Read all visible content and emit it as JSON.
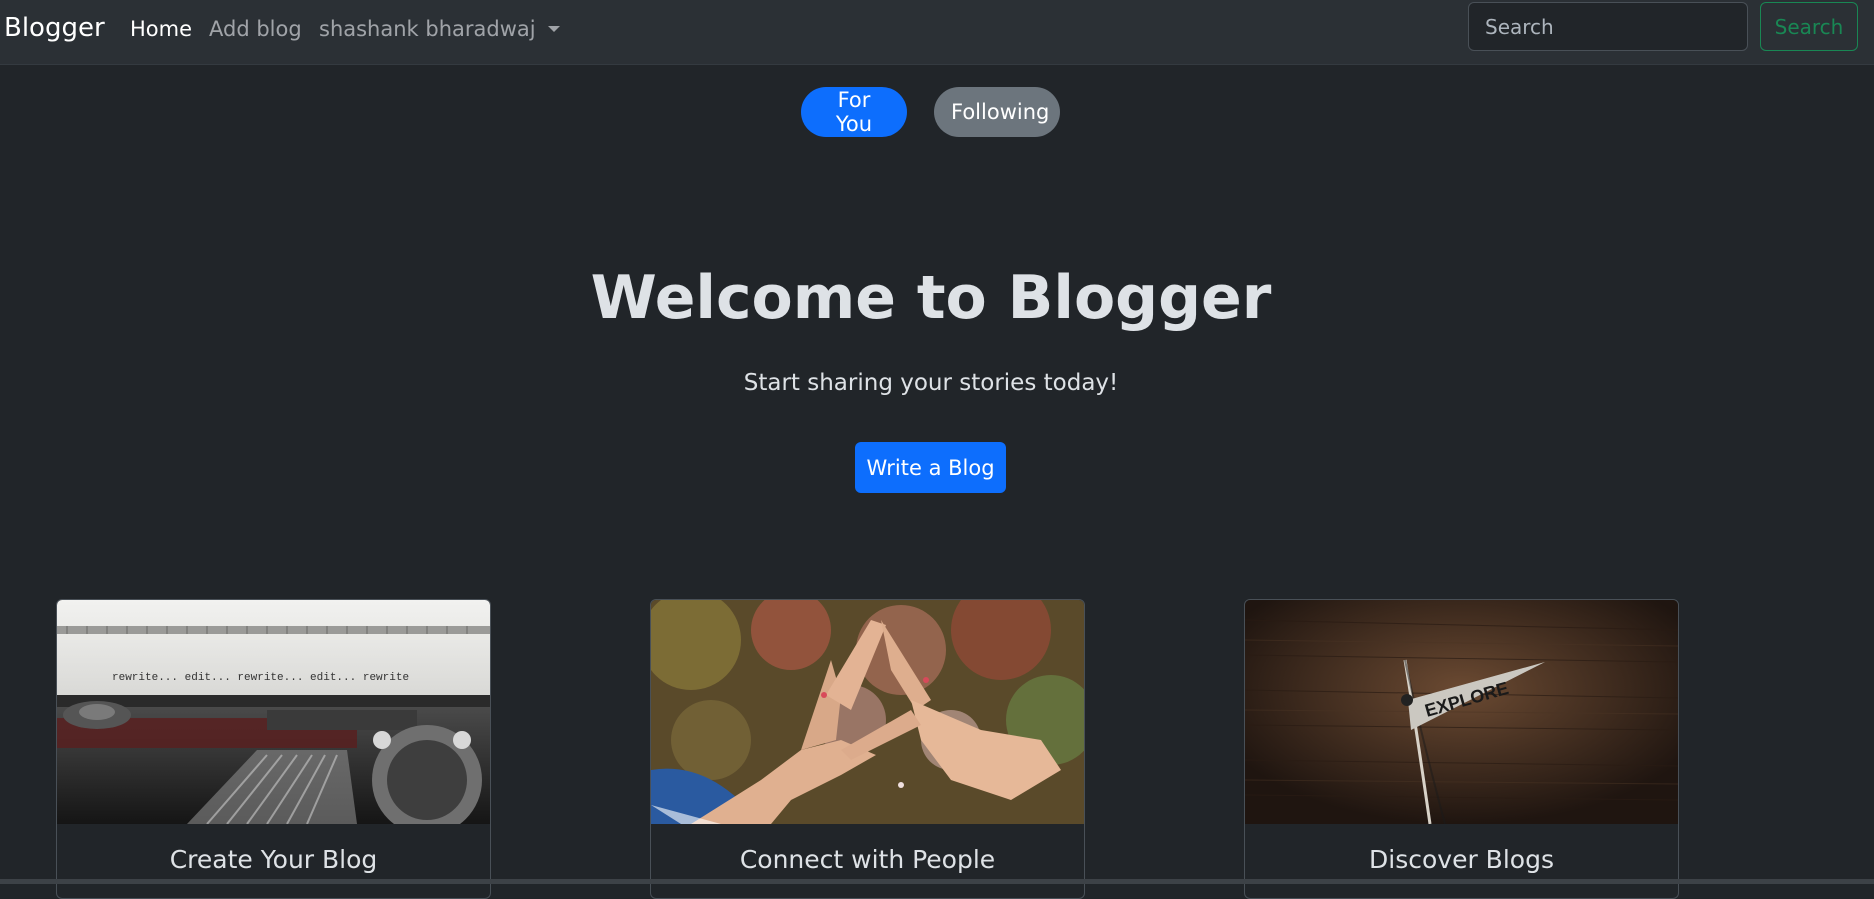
{
  "navbar": {
    "brand": "Blogger",
    "links": {
      "home": "Home",
      "add_blog": "Add blog",
      "user": "shashank bharadwaj"
    },
    "search": {
      "placeholder": "Search",
      "button_label": "Search"
    }
  },
  "feed_tabs": {
    "for_you": "For You",
    "following": "Following"
  },
  "hero": {
    "title": "Welcome to Blogger",
    "subtitle": "Start sharing your stories today!",
    "cta_label": "Write a Blog"
  },
  "cards": [
    {
      "title": "Create Your Blog",
      "image_text": "rewrite... edit... rewrite... edit... rewrite"
    },
    {
      "title": "Connect with People"
    },
    {
      "title": "Discover Blogs",
      "image_text": "EXPLORE"
    }
  ],
  "colors": {
    "background": "#212529",
    "navbar": "#2b3035",
    "primary": "#0d6efd",
    "secondary": "#6c757d",
    "success": "#198754"
  }
}
